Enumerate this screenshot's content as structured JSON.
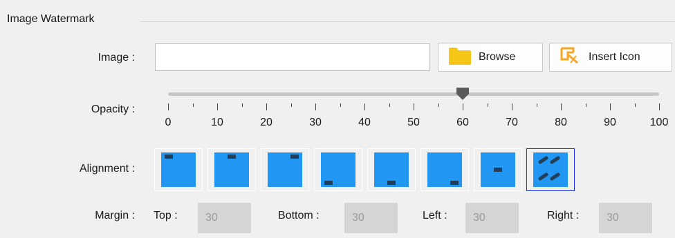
{
  "group": {
    "title": "Image Watermark"
  },
  "image": {
    "label": "Image :",
    "value": "",
    "browse_label": "Browse",
    "insert_icon_label": "Insert Icon"
  },
  "opacity": {
    "label": "Opacity :",
    "value": 60,
    "min": 0,
    "max": 100,
    "tick_labels": [
      "0",
      "10",
      "20",
      "30",
      "40",
      "50",
      "60",
      "70",
      "80",
      "90",
      "100"
    ]
  },
  "alignment": {
    "label": "Alignment :",
    "options": [
      "top-left",
      "top-center",
      "top-right",
      "bottom-left",
      "bottom-center",
      "bottom-right",
      "center",
      "tile"
    ],
    "selected": "tile"
  },
  "margin": {
    "label": "Margin :",
    "top_label": "Top :",
    "top": "30",
    "bottom_label": "Bottom :",
    "bottom": "30",
    "left_label": "Left :",
    "left": "30",
    "right_label": "Right :",
    "right": "30"
  },
  "colors": {
    "accent": "#2196f3",
    "mark": "#1f3f5a",
    "selected_border": "#1a33d9",
    "folder_icon": "#f5c518",
    "insert_icon": "#f5a623"
  }
}
